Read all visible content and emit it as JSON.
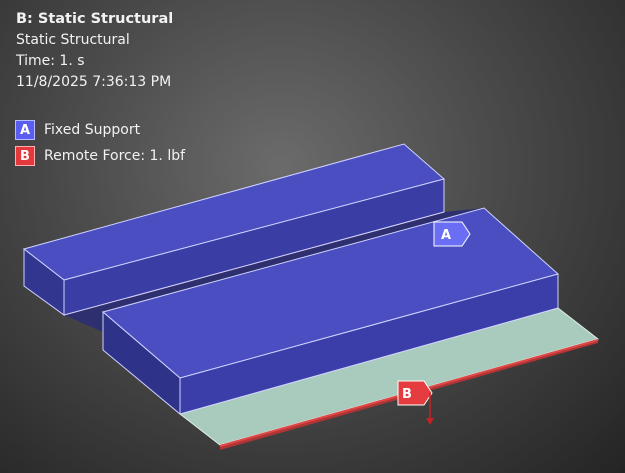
{
  "info": {
    "title": "B: Static Structural",
    "analysis_type": "Static Structural",
    "time": "Time: 1. s",
    "timestamp": "11/8/2025 7:36:13 PM"
  },
  "legend": [
    {
      "letter": "A",
      "label": "Fixed Support",
      "color": "#5a5ef0",
      "icon": "fixed-support-swatch"
    },
    {
      "letter": "B",
      "label": "Remote Force: 1. lbf",
      "color": "#e3383c",
      "icon": "remote-force-swatch"
    }
  ],
  "annotations": {
    "a_letter": "A",
    "b_letter": "B"
  },
  "colors": {
    "fixed_support": "#4448bf",
    "remote_force": "#d93a3a",
    "face_plate": "#a7c9bb"
  }
}
